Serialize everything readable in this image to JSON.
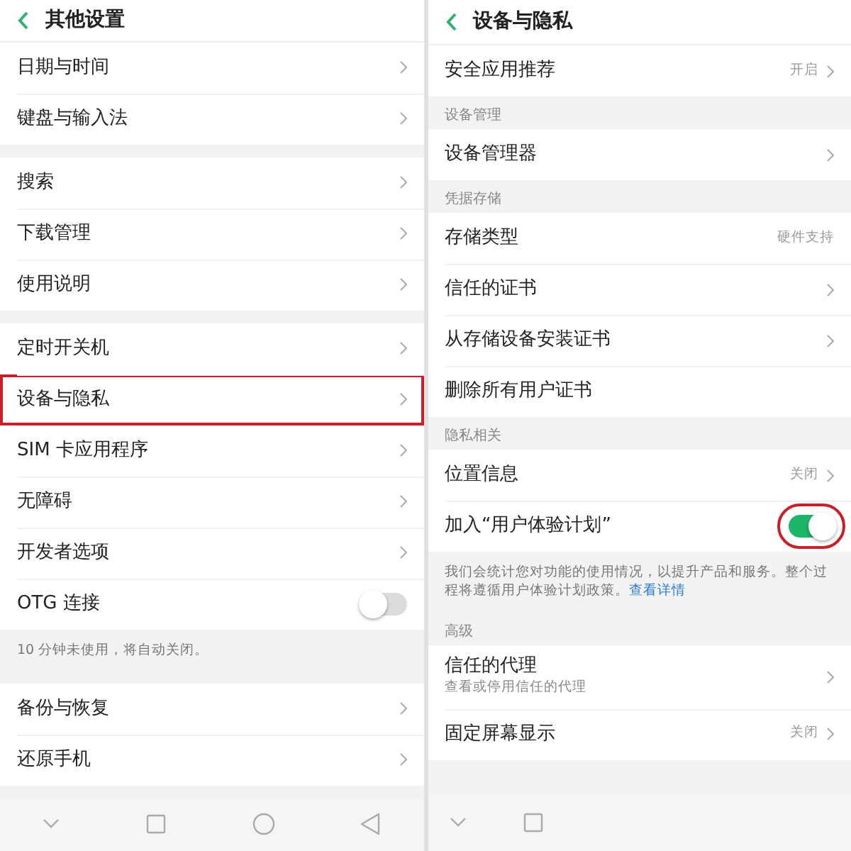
{
  "panels": [
    {
      "title": "其他设置",
      "groups": [
        {
          "items": [
            {
              "kind": "link",
              "label": "日期与时间",
              "highlighted": false
            },
            {
              "kind": "link",
              "label": "键盘与输入法",
              "highlighted": false
            }
          ]
        },
        {
          "items": [
            {
              "kind": "link",
              "label": "搜索",
              "highlighted": false
            },
            {
              "kind": "link",
              "label": "下载管理",
              "highlighted": false
            },
            {
              "kind": "link",
              "label": "使用说明",
              "highlighted": false
            }
          ]
        },
        {
          "items": [
            {
              "kind": "link",
              "label": "定时开关机",
              "highlighted": false
            },
            {
              "kind": "link",
              "label": "设备与隐私",
              "highlighted": true
            },
            {
              "kind": "link",
              "label": "SIM 卡应用程序",
              "highlighted": false
            },
            {
              "kind": "link",
              "label": "无障碍",
              "highlighted": false
            },
            {
              "kind": "link",
              "label": "开发者选项",
              "highlighted": false
            },
            {
              "kind": "toggle",
              "label": "OTG 连接",
              "on": false,
              "highlighted": false
            }
          ],
          "note": {
            "text": "10 分钟未使用，将自动关闭。"
          }
        },
        {
          "items": [
            {
              "kind": "link",
              "label": "备份与恢复",
              "highlighted": false
            },
            {
              "kind": "link",
              "label": "还原手机",
              "highlighted": false
            }
          ]
        }
      ],
      "nav": [
        {
          "kind": "down"
        },
        {
          "kind": "square"
        },
        {
          "kind": "circle"
        },
        {
          "kind": "back"
        }
      ]
    },
    {
      "title": "设备与隐私",
      "groups": [
        {
          "items": [
            {
              "kind": "link",
              "label": "安全应用推荐",
              "value": "开启",
              "highlighted": false
            }
          ]
        },
        {
          "header": "设备管理",
          "items": [
            {
              "kind": "link",
              "label": "设备管理器",
              "highlighted": false
            }
          ]
        },
        {
          "header": "凭据存储",
          "items": [
            {
              "kind": "info",
              "label": "存储类型",
              "value": "硬件支持",
              "highlighted": false
            },
            {
              "kind": "link",
              "label": "信任的证书",
              "highlighted": false
            },
            {
              "kind": "link",
              "label": "从存储设备安装证书",
              "highlighted": false
            },
            {
              "kind": "info",
              "label": "删除所有用户证书",
              "highlighted": false
            }
          ]
        },
        {
          "header": "隐私相关",
          "items": [
            {
              "kind": "link",
              "label": "位置信息",
              "value": "关闭",
              "highlighted": false
            },
            {
              "kind": "toggle",
              "label": "加入“用户体验计划”",
              "on": true,
              "highlighted": true
            }
          ],
          "note": {
            "text": "我们会统计您对功能的使用情况，以提升产品和服务。整个过程将遵循用户体验计划政策。",
            "link": "查看详情"
          }
        },
        {
          "header": "高级",
          "items": [
            {
              "kind": "link",
              "label": "信任的代理",
              "subtitle": "查看或停用信任的代理",
              "highlighted": false
            },
            {
              "kind": "link",
              "label": "固定屏幕显示",
              "value": "关闭",
              "highlighted": false
            }
          ]
        }
      ],
      "nav": [
        {
          "kind": "down"
        },
        {
          "kind": "square"
        }
      ]
    }
  ]
}
